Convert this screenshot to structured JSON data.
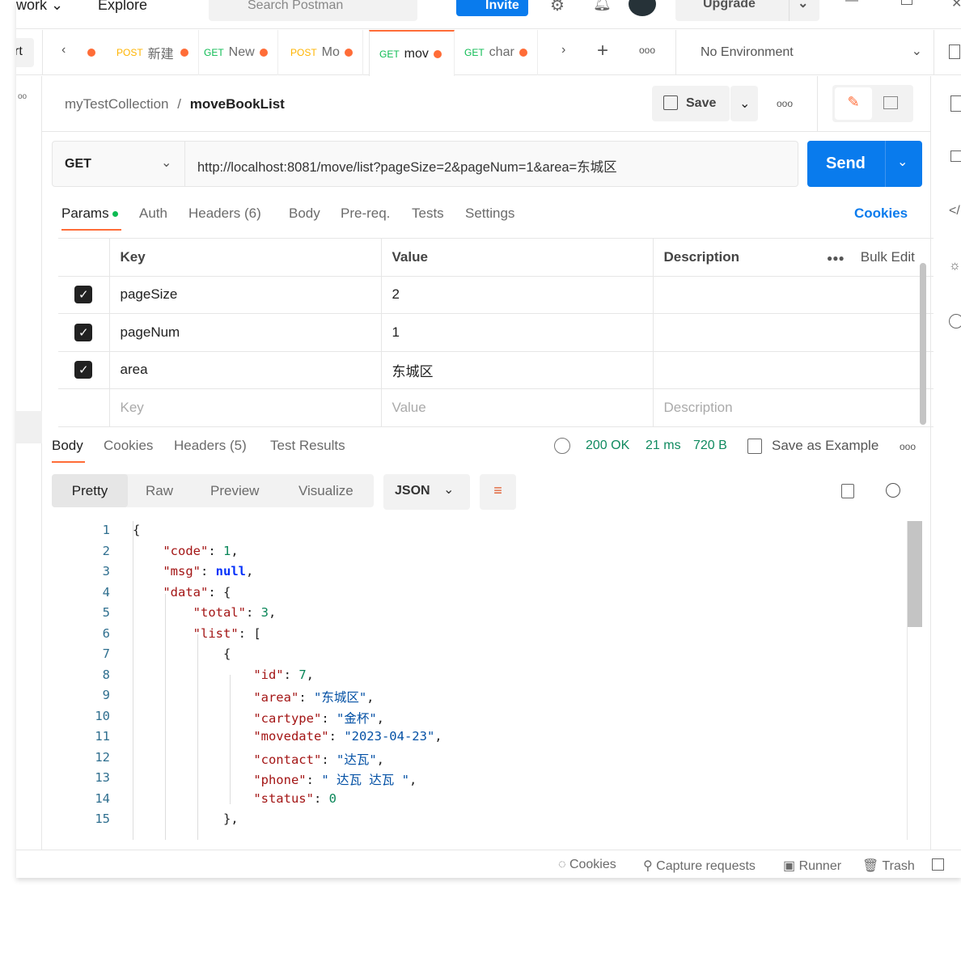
{
  "topbar": {
    "workspaces": "work",
    "explore": "Explore",
    "search_placeholder": "Search Postman",
    "invite": "Invite",
    "upgrade": "Upgrade"
  },
  "tabs": {
    "partial_left": "rt",
    "items": [
      {
        "method": "POST",
        "name": "新建",
        "unsaved": true
      },
      {
        "method": "GET",
        "name": "New",
        "unsaved": true
      },
      {
        "method": "POST",
        "name": "Mo",
        "unsaved": true
      },
      {
        "method": "GET",
        "name": "mov",
        "unsaved": true,
        "active": true
      },
      {
        "method": "GET",
        "name": "char",
        "unsaved": true
      }
    ],
    "environment": "No Environment"
  },
  "breadcrumb": {
    "collection": "myTestCollection",
    "separator": "/",
    "request": "moveBookList"
  },
  "actions": {
    "save": "Save"
  },
  "request": {
    "method": "GET",
    "url": "http://localhost:8081/move/list?pageSize=2&pageNum=1&area=东城区",
    "send": "Send"
  },
  "request_tabs": {
    "params": "Params",
    "auth": "Auth",
    "headers": "Headers (6)",
    "body": "Body",
    "prereq": "Pre-req.",
    "tests": "Tests",
    "settings": "Settings",
    "cookies": "Cookies"
  },
  "params": {
    "headers": {
      "key": "Key",
      "value": "Value",
      "description": "Description",
      "bulk_edit": "Bulk Edit"
    },
    "rows": [
      {
        "key": "pageSize",
        "value": "2",
        "checked": true
      },
      {
        "key": "pageNum",
        "value": "1",
        "checked": true
      },
      {
        "key": "area",
        "value": "东城区",
        "checked": true
      }
    ],
    "placeholder": {
      "key": "Key",
      "value": "Value",
      "description": "Description"
    }
  },
  "response": {
    "tabs": {
      "body": "Body",
      "cookies": "Cookies",
      "headers": "Headers (5)",
      "test_results": "Test Results"
    },
    "status": "200 OK",
    "time": "21 ms",
    "size": "720 B",
    "save_example": "Save as Example",
    "views": {
      "pretty": "Pretty",
      "raw": "Raw",
      "preview": "Preview",
      "visualize": "Visualize"
    },
    "format": "JSON",
    "lines": [
      [
        [
          "p",
          "{"
        ]
      ],
      [
        [
          "p",
          "    "
        ],
        [
          "k",
          "\"code\""
        ],
        [
          "p",
          ": "
        ],
        [
          "n",
          "1"
        ],
        [
          "p",
          ","
        ]
      ],
      [
        [
          "p",
          "    "
        ],
        [
          "k",
          "\"msg\""
        ],
        [
          "p",
          ": "
        ],
        [
          "nl",
          "null"
        ],
        [
          "p",
          ","
        ]
      ],
      [
        [
          "p",
          "    "
        ],
        [
          "k",
          "\"data\""
        ],
        [
          "p",
          ": {"
        ]
      ],
      [
        [
          "p",
          "        "
        ],
        [
          "k",
          "\"total\""
        ],
        [
          "p",
          ": "
        ],
        [
          "n",
          "3"
        ],
        [
          "p",
          ","
        ]
      ],
      [
        [
          "p",
          "        "
        ],
        [
          "k",
          "\"list\""
        ],
        [
          "p",
          ": ["
        ]
      ],
      [
        [
          "p",
          "            {"
        ]
      ],
      [
        [
          "p",
          "                "
        ],
        [
          "k",
          "\"id\""
        ],
        [
          "p",
          ": "
        ],
        [
          "n",
          "7"
        ],
        [
          "p",
          ","
        ]
      ],
      [
        [
          "p",
          "                "
        ],
        [
          "k",
          "\"area\""
        ],
        [
          "p",
          ": "
        ],
        [
          "s",
          "\"东城区\""
        ],
        [
          "p",
          ","
        ]
      ],
      [
        [
          "p",
          "                "
        ],
        [
          "k",
          "\"cartype\""
        ],
        [
          "p",
          ": "
        ],
        [
          "s",
          "\"金杯\""
        ],
        [
          "p",
          ","
        ]
      ],
      [
        [
          "p",
          "                "
        ],
        [
          "k",
          "\"movedate\""
        ],
        [
          "p",
          ": "
        ],
        [
          "s",
          "\"2023-04-23\""
        ],
        [
          "p",
          ","
        ]
      ],
      [
        [
          "p",
          "                "
        ],
        [
          "k",
          "\"contact\""
        ],
        [
          "p",
          ": "
        ],
        [
          "s",
          "\"达瓦\""
        ],
        [
          "p",
          ","
        ]
      ],
      [
        [
          "p",
          "                "
        ],
        [
          "k",
          "\"phone\""
        ],
        [
          "p",
          ": "
        ],
        [
          "s",
          "\" 达瓦 达瓦 \""
        ],
        [
          "p",
          ","
        ]
      ],
      [
        [
          "p",
          "                "
        ],
        [
          "k",
          "\"status\""
        ],
        [
          "p",
          ": "
        ],
        [
          "n",
          "0"
        ]
      ],
      [
        [
          "p",
          "            },"
        ]
      ]
    ]
  },
  "footer": {
    "cookies": "Cookies",
    "capture": "Capture requests",
    "runner": "Runner",
    "trash": "Trash"
  },
  "colors": {
    "accent": "#ff6c37",
    "send": "#097bed",
    "status": "#0f8a5f"
  }
}
